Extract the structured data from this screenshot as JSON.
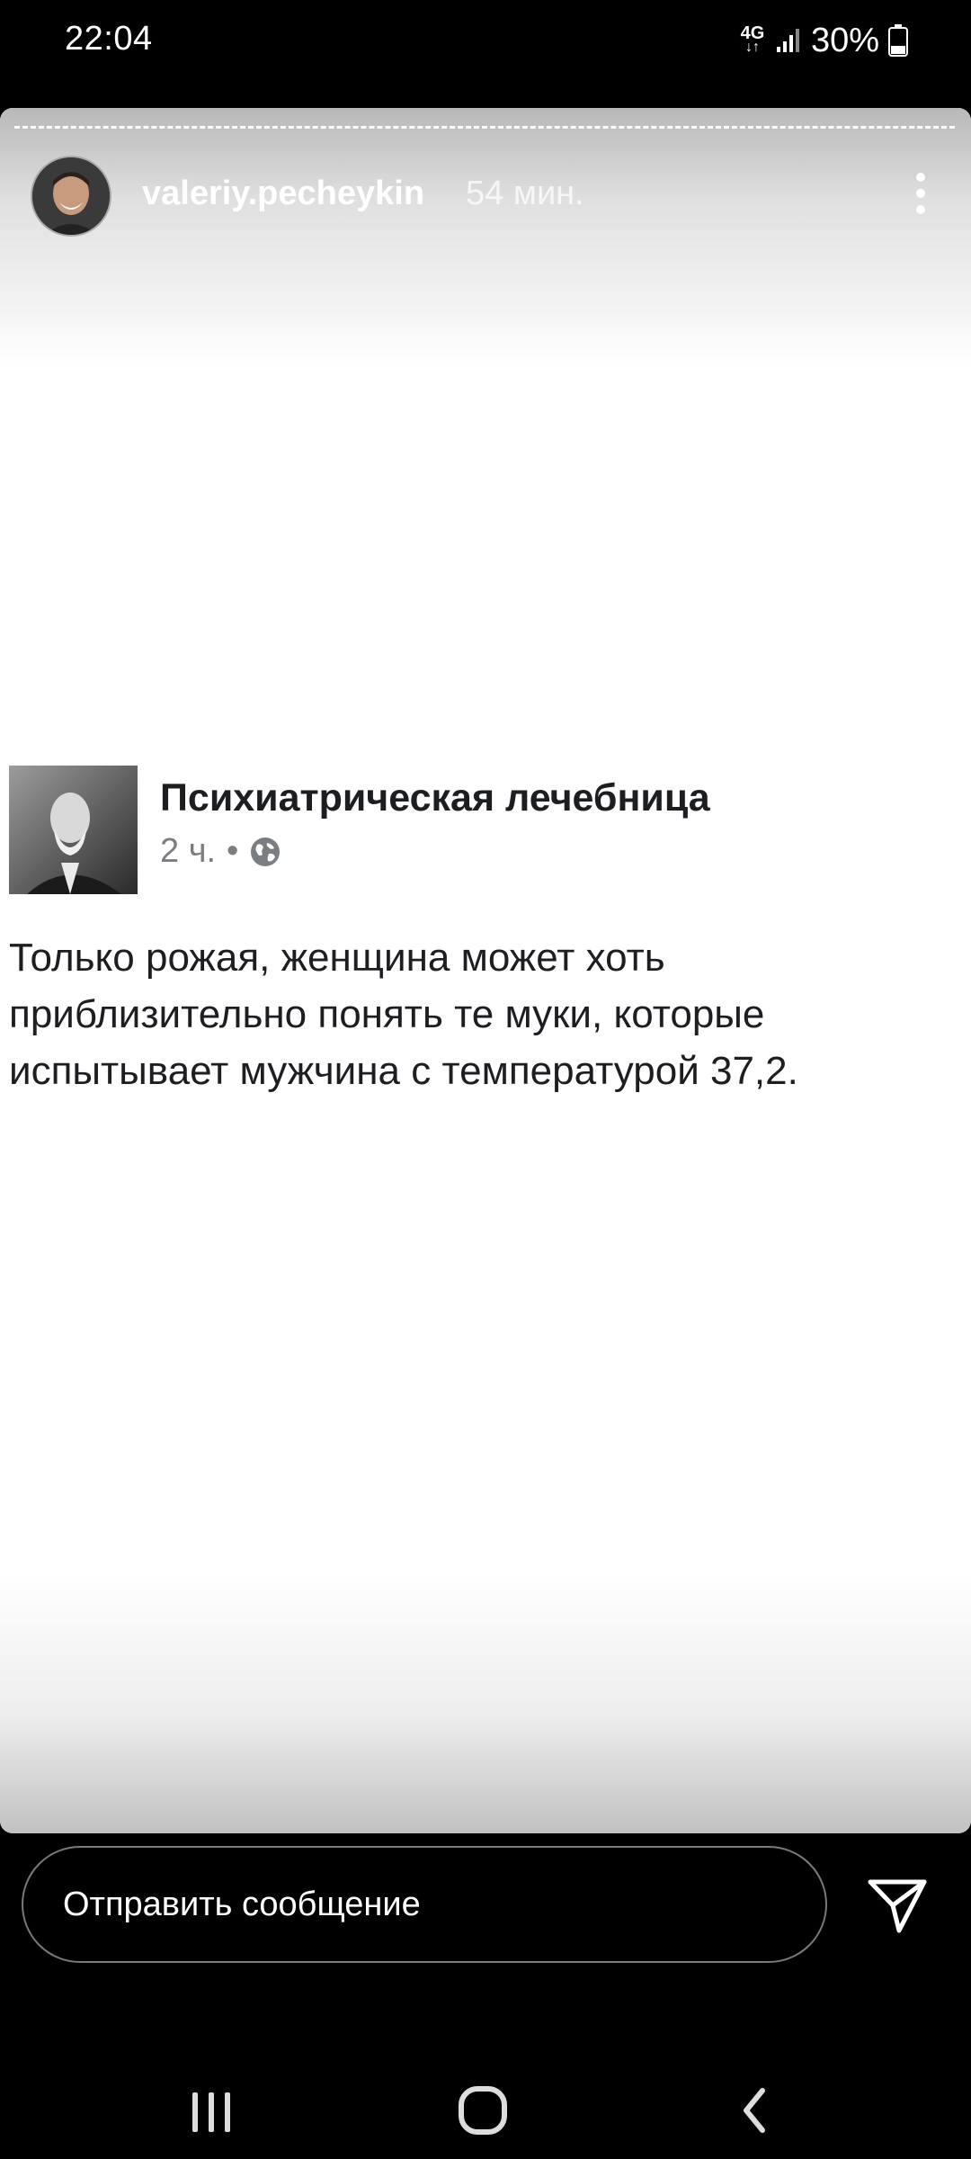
{
  "status_bar": {
    "time": "22:04",
    "network": "4G",
    "battery_percent": "30%"
  },
  "story": {
    "username": "valeriy.pecheykin",
    "time_ago": "54 мин.",
    "icons": {
      "more": "more-vertical-icon",
      "avatar": "profile-photo"
    }
  },
  "post": {
    "page_name": "Психиатрическая лечебница",
    "time": "2 ч.",
    "separator": "•",
    "audience_icon": "globe-icon",
    "text": "Только рожая, женщина может хоть приблизительно понять те муки, которые испытывает мужчина с температурой 37,2."
  },
  "reply": {
    "placeholder": "Отправить сообщение",
    "send_icon": "send-icon"
  },
  "nav": {
    "recents_icon": "recents-icon",
    "home_icon": "home-icon",
    "back_icon": "back-icon"
  },
  "colors": {
    "background": "#000000",
    "card": "#ffffff",
    "post_text": "#1c1e21",
    "meta_text": "#7a7d81"
  }
}
